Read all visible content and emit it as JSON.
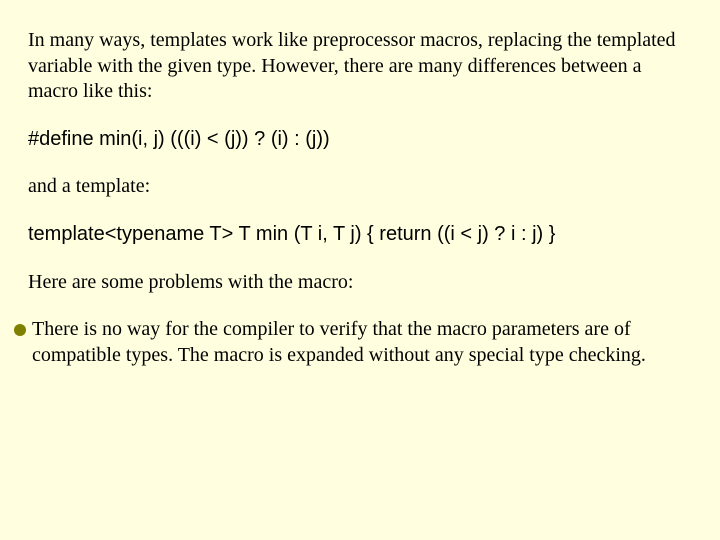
{
  "slide": {
    "intro": "In many ways, templates work like preprocessor macros, replacing the templated variable with the given type. However, there are many differences between a macro like this:",
    "macro_code": "#define min(i, j) (((i) < (j)) ? (i) : (j))",
    "and_template": "and a template:",
    "template_code": "template<typename T> T min (T i, T j) { return ((i < j) ? i : j) }",
    "problems_intro": "Here are some problems with the macro:",
    "bullets": [
      "There is no way for the compiler to verify that the macro parameters are of compatible types. The macro is expanded without any special type checking."
    ]
  }
}
